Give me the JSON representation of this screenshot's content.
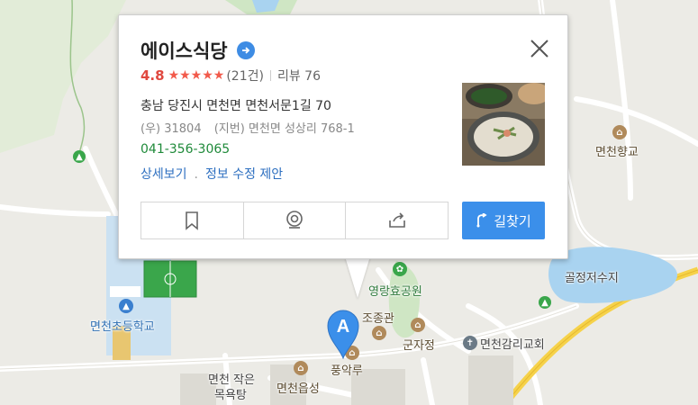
{
  "popup": {
    "title": "에이스식당",
    "rating_score": "4.8",
    "stars": "★★★★★",
    "rating_count": "(21건)",
    "review_label": "리뷰 76",
    "address": "충남 당진시 면천면 면천서문1길 70",
    "postal": "(우) 31804",
    "lot_address": "(지번) 면천면 성상리 768-1",
    "phone": "041-356-3065",
    "link_detail": "상세보기",
    "link_separator": ".",
    "link_edit": "정보 수정 제안",
    "route_label": "길찾기",
    "icons": [
      "arrow-right-circle-icon",
      "close-icon",
      "bookmark-icon",
      "roadview-icon",
      "share-icon",
      "route-icon"
    ]
  },
  "marker": {
    "label": "A",
    "color": "#3b8fea"
  },
  "map_labels": {
    "myeoncheon_hyanggyo": "면천향교",
    "goljeong_reservoir": "골정저수지",
    "myeoncheon_elementary": "면천초등학교",
    "yeongnang_park": "영랑효공원",
    "jojonggwan": "조종관",
    "gunjajeong": "군자정",
    "myeoncheon_church": "면천감리교회",
    "pungakru": "풍악루",
    "small_bath_1": "면천 작은",
    "small_bath_2": "목욕탕",
    "eupseong": "면천읍성"
  },
  "colors": {
    "accent": "#3b8fea",
    "rating": "#e0483f",
    "phone": "#1f8a3a",
    "link": "#2d6fc0",
    "road_major": "#f6d24a",
    "water": "#a9d3f0",
    "park": "#cfe6c4"
  }
}
